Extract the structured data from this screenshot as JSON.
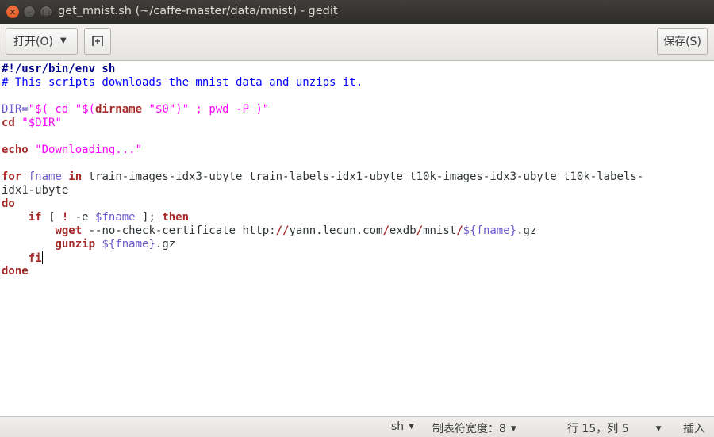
{
  "window": {
    "title": "get_mnist.sh (~/caffe-master/data/mnist) - gedit"
  },
  "headerbar": {
    "open_label": "打开(O)",
    "new_tab_icon": "new-document-icon",
    "save_label": "保存(S)"
  },
  "editor": {
    "lines": [
      [
        {
          "t": "#!/usr/bin/env sh",
          "c": "shebang"
        }
      ],
      [
        {
          "t": "# This scripts downloads the mnist data and unzips it.",
          "c": "comment"
        }
      ],
      [],
      [
        {
          "t": "DIR=",
          "c": "var"
        },
        {
          "t": "\"$( cd \"$(",
          "c": "string"
        },
        {
          "t": "dirname",
          "c": "bold"
        },
        {
          "t": " \"$0\")\" ; pwd -P )\"",
          "c": "string"
        }
      ],
      [
        {
          "t": "cd",
          "c": "keyword"
        },
        {
          "t": " ",
          "c": "plain"
        },
        {
          "t": "\"$DIR\"",
          "c": "string"
        }
      ],
      [],
      [
        {
          "t": "echo",
          "c": "keyword"
        },
        {
          "t": " ",
          "c": "plain"
        },
        {
          "t": "\"Downloading...\"",
          "c": "string"
        }
      ],
      [],
      [
        {
          "t": "for",
          "c": "keyword"
        },
        {
          "t": " ",
          "c": "plain"
        },
        {
          "t": "fname",
          "c": "var"
        },
        {
          "t": " ",
          "c": "plain"
        },
        {
          "t": "in",
          "c": "keyword"
        },
        {
          "t": " train-images-idx3-ubyte train-labels-idx1-ubyte t10k-images-idx3-ubyte t10k-labels-",
          "c": "plain"
        }
      ],
      [
        {
          "t": "idx1-ubyte",
          "c": "plain"
        }
      ],
      [
        {
          "t": "do",
          "c": "keyword"
        }
      ],
      [
        {
          "t": "    ",
          "c": "plain"
        },
        {
          "t": "if",
          "c": "keyword"
        },
        {
          "t": " [ ",
          "c": "plain"
        },
        {
          "t": "!",
          "c": "keyword"
        },
        {
          "t": " -e ",
          "c": "plain"
        },
        {
          "t": "$fname",
          "c": "var"
        },
        {
          "t": " ]; ",
          "c": "plain"
        },
        {
          "t": "then",
          "c": "keyword"
        }
      ],
      [
        {
          "t": "        ",
          "c": "plain"
        },
        {
          "t": "wget",
          "c": "keyword"
        },
        {
          "t": " --no-check-certificate http:",
          "c": "plain"
        },
        {
          "t": "//",
          "c": "keyword"
        },
        {
          "t": "yann.lecun.com",
          "c": "plain"
        },
        {
          "t": "/",
          "c": "keyword"
        },
        {
          "t": "exdb",
          "c": "plain"
        },
        {
          "t": "/",
          "c": "keyword"
        },
        {
          "t": "mnist",
          "c": "plain"
        },
        {
          "t": "/",
          "c": "keyword"
        },
        {
          "t": "${fname}",
          "c": "var"
        },
        {
          "t": ".gz",
          "c": "plain"
        }
      ],
      [
        {
          "t": "        ",
          "c": "plain"
        },
        {
          "t": "gunzip",
          "c": "keyword"
        },
        {
          "t": " ",
          "c": "plain"
        },
        {
          "t": "${fname}",
          "c": "var"
        },
        {
          "t": ".gz",
          "c": "plain"
        }
      ],
      [
        {
          "t": "    ",
          "c": "plain"
        },
        {
          "t": "fi",
          "c": "keyword"
        }
      ],
      [
        {
          "t": "done",
          "c": "keyword"
        }
      ]
    ],
    "cursor_line": 15
  },
  "statusbar": {
    "language": "sh",
    "tab_width": "制表符宽度：8",
    "position": "行 15，列 5",
    "mode": "插入"
  },
  "colors": {
    "comment": "#0000ff",
    "keyword": "#a52a2a",
    "string": "#ff00ff",
    "variable": "#6a5acd",
    "title_bar": "#3a3935",
    "close_button": "#e95420"
  }
}
